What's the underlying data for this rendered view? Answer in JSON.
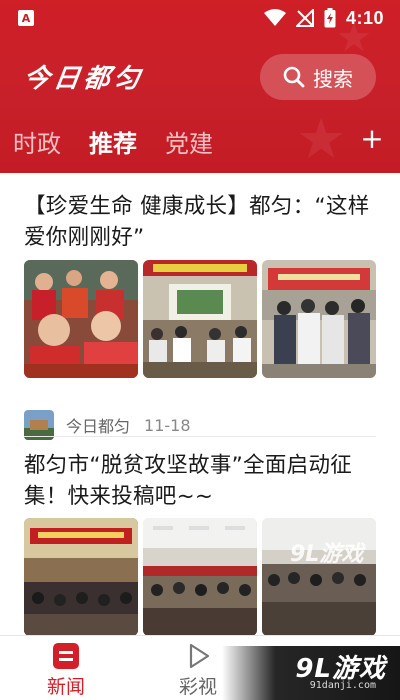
{
  "status_bar": {
    "app_icon_letter": "A",
    "time": "4:10"
  },
  "header": {
    "logo_text": "今日都匀",
    "search_label": "搜索",
    "tabs": [
      {
        "label": "时政",
        "active": false
      },
      {
        "label": "推荐",
        "active": true
      },
      {
        "label": "党建",
        "active": false
      }
    ],
    "add_tab_symbol": "+"
  },
  "feed": {
    "articles": [
      {
        "title": "【珍爱生命 健康成长】都匀：“这样爱你刚刚好”",
        "images": [
          "children-activity-photo",
          "classroom-presentation-photo",
          "students-viewing-exhibit-photo"
        ],
        "source": "今日都匀",
        "date": "11-18"
      },
      {
        "title": "都匀市“脱贫攻坚故事”全面启动征集！快来投稿吧~~",
        "images": [
          "conference-stage-photo",
          "meeting-hall-photo",
          "audience-hall-photo"
        ]
      }
    ]
  },
  "bottom_nav": {
    "items": [
      {
        "label": "新闻",
        "icon": "news-icon",
        "active": true
      },
      {
        "label": "彩视",
        "icon": "play-icon",
        "active": false
      }
    ]
  },
  "watermark": {
    "brand": "9L游戏",
    "url": "91danji.com",
    "thumb_mark": "9L游戏"
  },
  "colors": {
    "brand_red": "#c8202a",
    "active_nav": "#d21f28"
  }
}
